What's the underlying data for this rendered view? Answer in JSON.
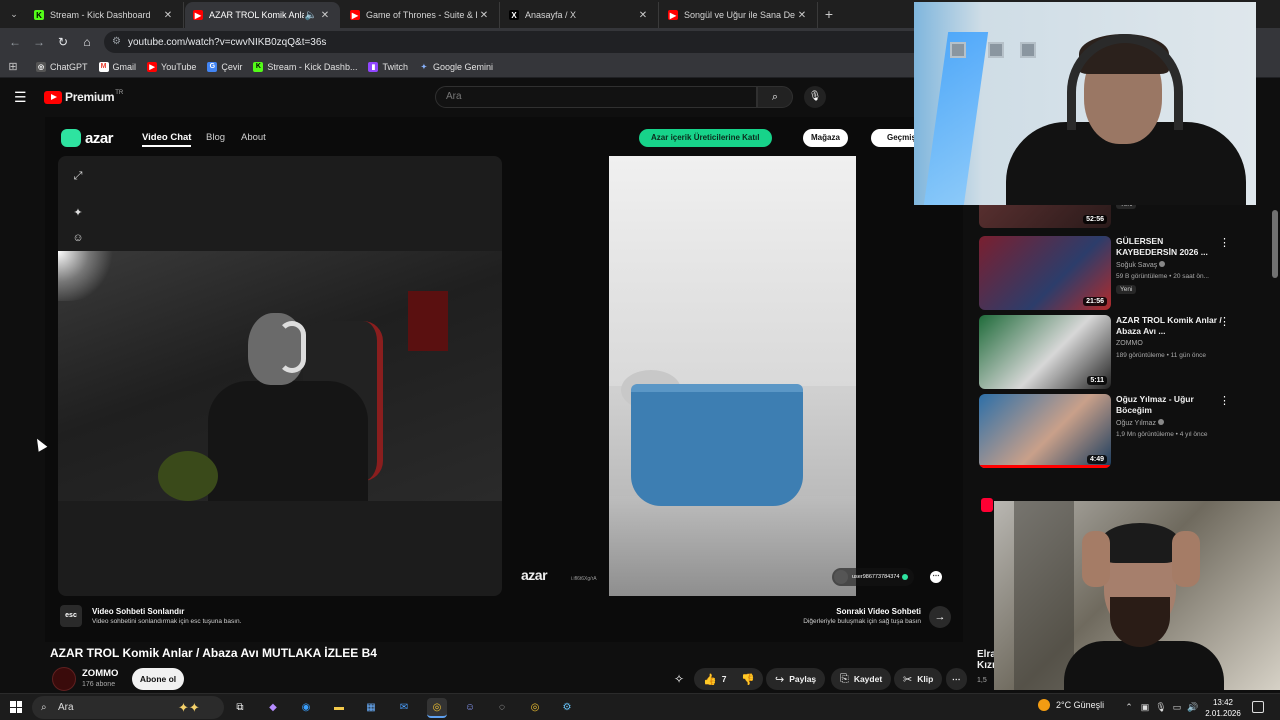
{
  "browser": {
    "tabs": [
      {
        "label": "Stream - Kick Dashboard",
        "favicon": "kick-icon",
        "color": "#53fc18",
        "glyph": "K"
      },
      {
        "label": "AZAR TROL Komik Anlar / A",
        "favicon": "youtube-icon",
        "color": "#ff0000",
        "glyph": "▶",
        "active": true,
        "audio": "🔊"
      },
      {
        "label": "Game of Thrones - Suite & Rai",
        "favicon": "youtube-icon",
        "color": "#ff0000",
        "glyph": "▶"
      },
      {
        "label": "Anasayfa / X",
        "favicon": "x-icon",
        "color": "#000000",
        "glyph": "𝕏"
      },
      {
        "label": "Songül ve Uğur ile Sana Değer",
        "favicon": "youtube-icon",
        "color": "#ff0000",
        "glyph": "▶"
      }
    ],
    "url": "youtube.com/watch?v=cwvNIKB0zqQ&t=36s",
    "bookmarks": [
      {
        "label": "ChatGPT",
        "favicon": "chatgpt-icon",
        "color": "#888888",
        "glyph": "◎"
      },
      {
        "label": "Gmail",
        "favicon": "gmail-icon",
        "color": "#ea4335",
        "glyph": "M"
      },
      {
        "label": "YouTube",
        "favicon": "youtube-icon",
        "color": "#ff0000",
        "glyph": "▶"
      },
      {
        "label": "Çevir",
        "favicon": "translate-icon",
        "color": "#4285f4",
        "glyph": "G"
      },
      {
        "label": "Stream - Kick Dashb...",
        "favicon": "kick-icon",
        "color": "#53fc18",
        "glyph": "K"
      },
      {
        "label": "Twitch",
        "favicon": "twitch-icon",
        "color": "#9146ff",
        "glyph": "▮"
      },
      {
        "label": "Google Gemini",
        "favicon": "gemini-icon",
        "color": "#7b8cff",
        "glyph": "✦"
      }
    ]
  },
  "youtube": {
    "logo_text": "Premium",
    "region": "TR",
    "search_placeholder": "Ara"
  },
  "azar": {
    "logo": "azar",
    "nav": [
      "Video Chat",
      "Blog",
      "About"
    ],
    "creator_button": "Azar içerik Üreticilerine Katıl",
    "store_button": "Mağaza",
    "history_button": "Geçmiş",
    "watermark": "azar",
    "watermark_sub": "i.ifl6t6Xg/rA",
    "peer_name": "user986773784374",
    "esc_key": "esc",
    "end_title": "Video Sohbeti Sonlandır",
    "end_sub": "Video sohbetini sonlandırmak için esc tuşuna basın.",
    "next_title": "Sonraki Video Sohbeti",
    "next_sub": "Diğerleriyle buluşmak için sağ tuşa basın"
  },
  "video": {
    "title": "AZAR TROL Komik Anlar / Abaza Avı MUTLAKA İZLEE B4",
    "channel": "ZOMMO",
    "subscribers": "176 abone",
    "subscribe_label": "Abone ol",
    "likes": "7",
    "share": "Paylaş",
    "save": "Kaydet",
    "clip": "Klip"
  },
  "sidebar": {
    "items": [
      {
        "title": "",
        "channel": "",
        "meta": "",
        "badge": "Yeni",
        "duration": "52:56",
        "thumb": "#4a2a2a"
      },
      {
        "title": "GÜLERSEN KAYBEDERSİN 2026 ...",
        "channel": "Soğuk Savaş",
        "meta": "59 B görüntüleme • 20 saat ön...",
        "badge": "Yeni",
        "duration": "21:56",
        "thumb": "#6b1b2b"
      },
      {
        "title": "AZAR TROL Komik Anlar / Abaza Avı ...",
        "channel": "ZOMMO",
        "meta": "189 görüntüleme • 11 gün önce",
        "badge": "",
        "duration": "5:11",
        "thumb": "#2f6b3a"
      },
      {
        "title": "Oğuz Yılmaz - Uğur Böceğim",
        "channel": "Oğuz Yılmaz",
        "meta": "1,9 Mn görüntüleme • 4 yıl önce",
        "badge": "",
        "duration": "4:49",
        "thumb": "#1d4f7a"
      }
    ],
    "cut_title": "Elra",
    "cut_title2": "Kızı",
    "cut_meta": "1,5"
  },
  "taskbar": {
    "search": "Ara",
    "weather": "2°C  Güneşli",
    "time": "13:42",
    "date": "2.01.2026"
  }
}
